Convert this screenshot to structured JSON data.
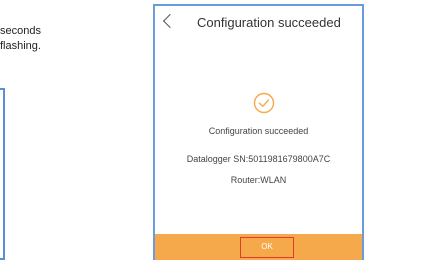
{
  "instructions": {
    "line1": "seconds",
    "line2": "flashing."
  },
  "header": {
    "title": "Configuration succeeded"
  },
  "result": {
    "status_text": "Configuration succeeded",
    "datalogger_sn": "Datalogger SN:5011981679800A7C",
    "router": "Router:WLAN"
  },
  "footer": {
    "ok_label": "OK"
  },
  "colors": {
    "accent": "#f5a94a",
    "highlight": "#e23b2e",
    "frame": "#6a9bdc"
  },
  "icons": {
    "back": "chevron-left-icon",
    "success": "check-circle-icon"
  }
}
